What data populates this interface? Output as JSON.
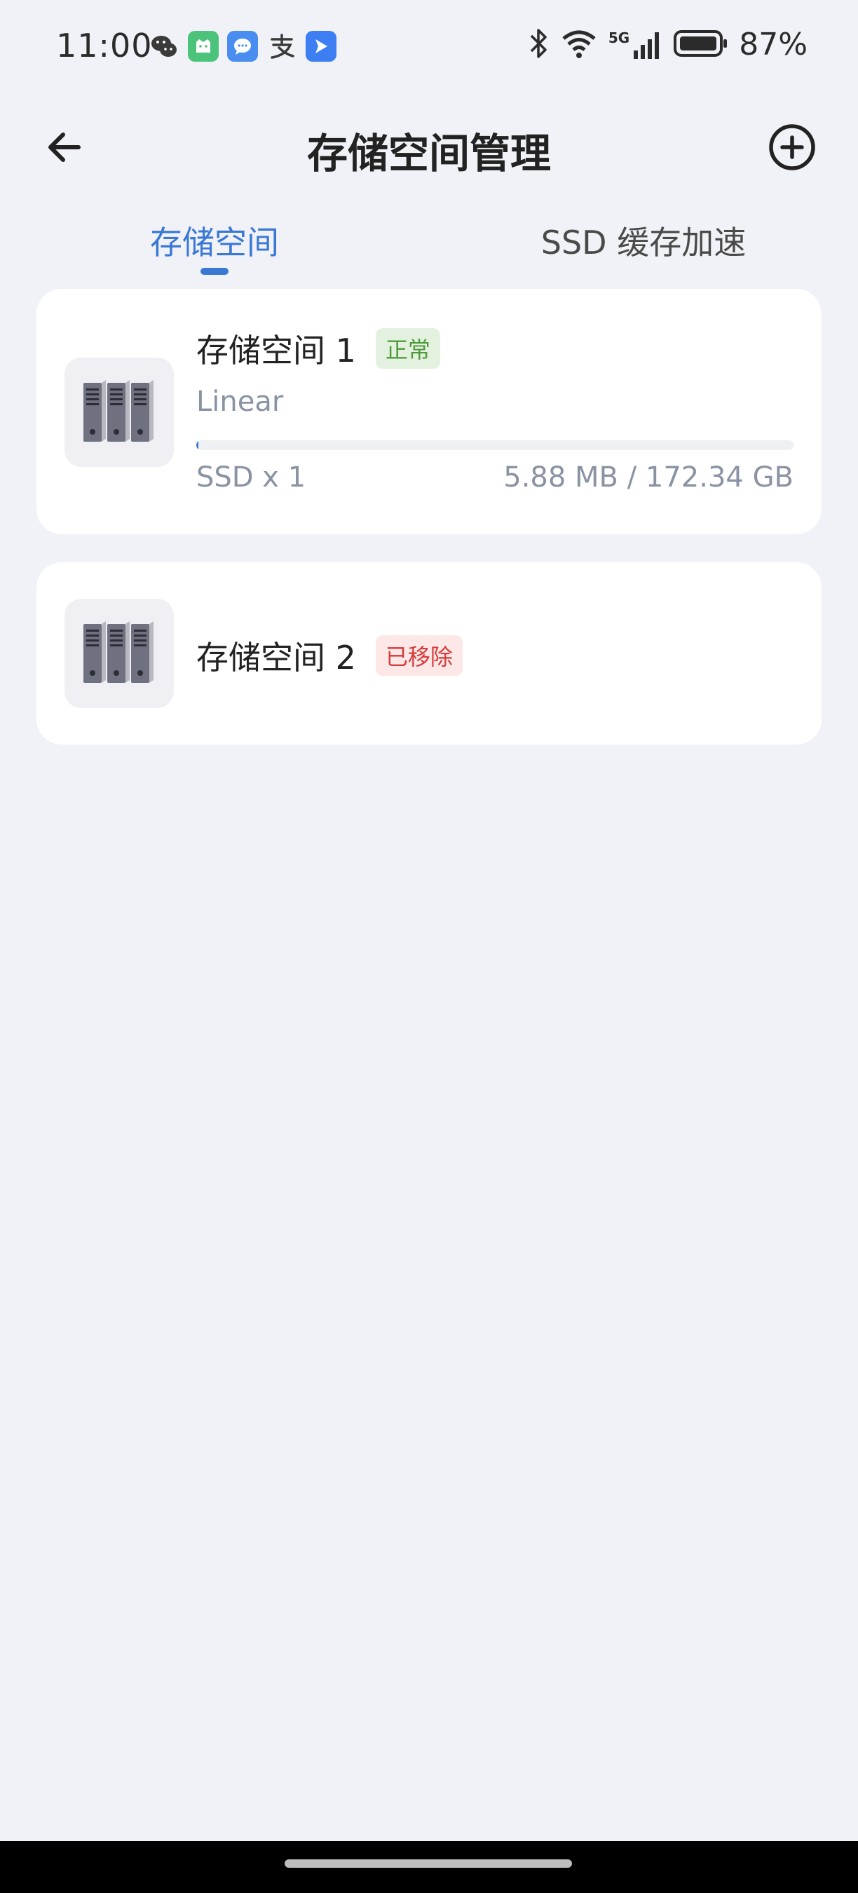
{
  "status_bar": {
    "time": "11:00",
    "notification_icons": [
      "wechat-icon",
      "mi-home-icon",
      "messages-icon",
      "alipay-icon",
      "feishu-icon"
    ],
    "system_icons": [
      "bluetooth-icon",
      "wifi-icon",
      "5g-signal-icon",
      "battery-icon"
    ],
    "network_label": "5G",
    "battery_percent": "87%"
  },
  "header": {
    "title": "存储空间管理",
    "back_icon": "arrow-left-icon",
    "add_icon": "plus-circle-icon"
  },
  "tabs": [
    {
      "label": "存储空间",
      "active": true
    },
    {
      "label": "SSD 缓存加速",
      "active": false
    }
  ],
  "pools": [
    {
      "name": "存储空间 1",
      "status": "正常",
      "raid_type": "Linear",
      "disks": "SSD x 1",
      "usage": "5.88 MB / 172.34 GB",
      "usage_fraction": 3e-05,
      "icon": "server-rack-icon"
    },
    {
      "name": "存储空间 2",
      "status": "已移除",
      "icon": "server-rack-icon"
    }
  ],
  "colors": {
    "accent": "#3a78d6",
    "background": "#f1f2f7",
    "status_ok": "#4f9a3c",
    "status_removed": "#d63a3a"
  }
}
